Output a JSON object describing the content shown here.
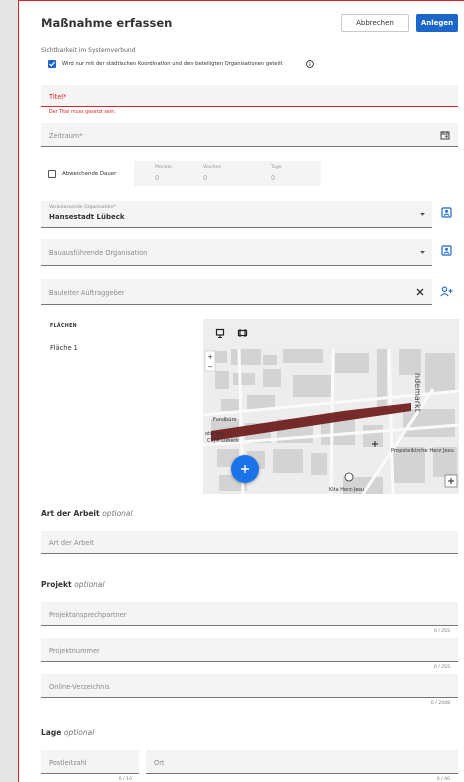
{
  "dialog": {
    "title": "Maßnahme erfassen",
    "cancel_label": "Abbrechen",
    "create_label": "Anlegen"
  },
  "visibility": {
    "label": "Sichtbarkeit im Systemverbund",
    "checkbox_label": "Wird nur mit der städtischen Koordination und den beteiligten Organisationen geteilt",
    "checked": true
  },
  "titel": {
    "placeholder": "Titel*",
    "error": "Der Titel muss gesetzt sein."
  },
  "zeitraum": {
    "placeholder": "Zeitraum*"
  },
  "duration": {
    "checkbox_label": "Abweichende Dauer",
    "months_label": "Monate",
    "months_value": "0",
    "weeks_label": "Wochen",
    "weeks_value": "0",
    "days_label": "Tage",
    "days_value": "0"
  },
  "organizer": {
    "label": "Veranlassende Organisation*",
    "value": "Hansestadt Lübeck"
  },
  "executor": {
    "placeholder": "Bauausführende Organisation"
  },
  "site_manager": {
    "placeholder": "Bauleiter Auftraggeber"
  },
  "areas": {
    "heading": "FLÄCHEN",
    "items": [
      "Fläche 1"
    ]
  },
  "map": {
    "labels": [
      "ndemarkt",
      "Propsteikirche Herz Jesu",
      "Kita Herz-Jesu",
      "CVJM Lübeck",
      "Fundbüro",
      "otel am"
    ],
    "route_color": "#6e1a1a",
    "fab_color": "#1a73e8"
  },
  "work_type": {
    "heading": "Art der Arbeit",
    "optional": "optional",
    "placeholder": "Art der Arbeit"
  },
  "project": {
    "heading": "Projekt",
    "optional": "optional",
    "contact_placeholder": "Projektansprechpartner",
    "contact_counter": "0 / 255",
    "number_placeholder": "Projektnummer",
    "number_counter": "0 / 255",
    "directory_placeholder": "Online-Verzeichnis",
    "directory_counter": "0 / 2048"
  },
  "location": {
    "heading": "Lage",
    "optional": "optional",
    "zip_placeholder": "Postleitzahl",
    "zip_counter": "0 / 10",
    "city_placeholder": "Ort",
    "city_counter": "0 / 40"
  },
  "colors": {
    "primary": "#1a66c9",
    "error": "#d9252a"
  }
}
